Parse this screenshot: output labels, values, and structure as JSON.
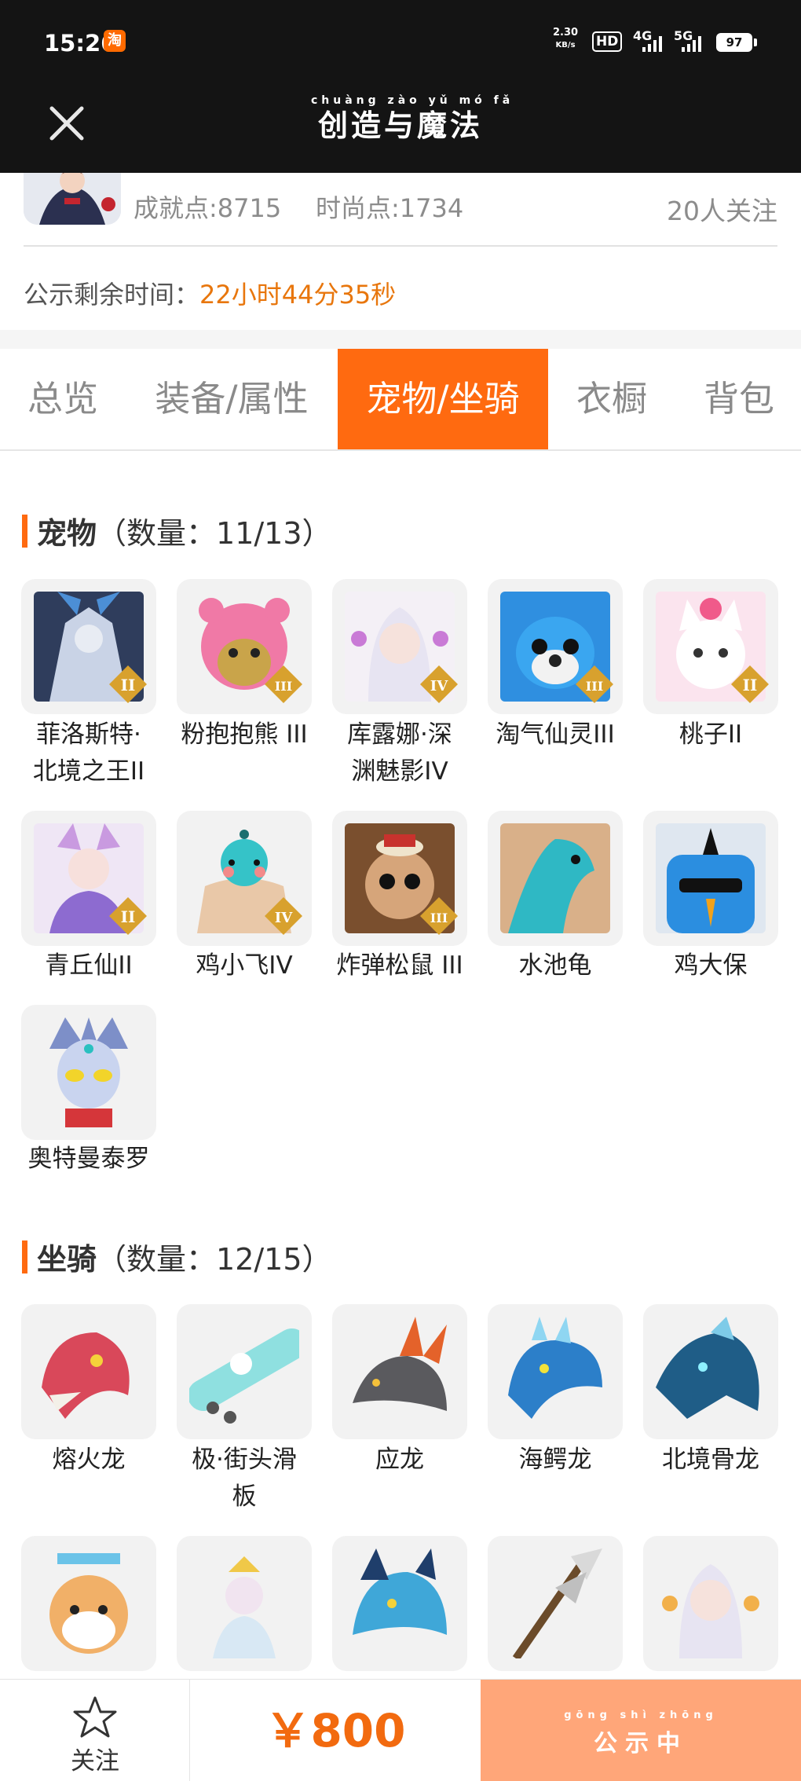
{
  "status_bar": {
    "time": "15:26",
    "app_badge": "淘",
    "net_rate_value": "2.30",
    "net_rate_unit": "KB/s",
    "hd": "HD",
    "sim1": "4G",
    "sim2": "5G",
    "battery": "97"
  },
  "header": {
    "close_icon": "close-icon",
    "logo_pinyin": "chuàng zào  yǔ  mó  fǎ",
    "logo_text": "创造与魔法"
  },
  "profile": {
    "achievement": "成就点:8715",
    "fashion": "时尚点:1734",
    "followers": "20人关注"
  },
  "countdown": {
    "label": "公示剩余时间：",
    "value": "22小时44分35秒"
  },
  "tabs": [
    {
      "label": "总览",
      "active": false
    },
    {
      "label": "装备/属性",
      "active": false
    },
    {
      "label": "宠物/坐骑",
      "active": true
    },
    {
      "label": "衣橱",
      "active": false
    },
    {
      "label": "背包",
      "active": false
    }
  ],
  "pets": {
    "title": "宠物",
    "count": "（数量：11/13）",
    "items": [
      {
        "name_line1": "菲洛斯特·",
        "name_line2": "北境之王II",
        "tier": "II"
      },
      {
        "name_line1": "粉抱抱熊 III",
        "name_line2": "",
        "tier": "III"
      },
      {
        "name_line1": "库露娜·深",
        "name_line2": "渊魅影IV",
        "tier": "IV"
      },
      {
        "name_line1": "淘气仙灵III",
        "name_line2": "",
        "tier": "III"
      },
      {
        "name_line1": "桃子II",
        "name_line2": "",
        "tier": "II"
      },
      {
        "name_line1": "青丘仙II",
        "name_line2": "",
        "tier": "II"
      },
      {
        "name_line1": "鸡小飞IV",
        "name_line2": "",
        "tier": "IV"
      },
      {
        "name_line1": "炸弹松鼠 III",
        "name_line2": "",
        "tier": "III"
      },
      {
        "name_line1": "水池龟",
        "name_line2": "",
        "tier": ""
      },
      {
        "name_line1": "鸡大保",
        "name_line2": "",
        "tier": ""
      },
      {
        "name_line1": "奥特曼泰罗",
        "name_line2": "",
        "tier": ""
      }
    ]
  },
  "mounts": {
    "title": "坐骑",
    "count": "（数量：12/15）",
    "items": [
      {
        "name_line1": "熔火龙",
        "name_line2": ""
      },
      {
        "name_line1": "极·街头滑",
        "name_line2": "板"
      },
      {
        "name_line1": "应龙",
        "name_line2": ""
      },
      {
        "name_line1": "海鳄龙",
        "name_line2": ""
      },
      {
        "name_line1": "北境骨龙",
        "name_line2": ""
      }
    ]
  },
  "bottom": {
    "follow_label": "关注",
    "price": "￥800",
    "status_pinyin": "gōng  shì  zhōng",
    "status_text": "公示中"
  },
  "colors": {
    "accent": "#ff6a10",
    "countdown": "#e8760c",
    "price": "#f26a0f",
    "status_button": "#ffa679"
  }
}
